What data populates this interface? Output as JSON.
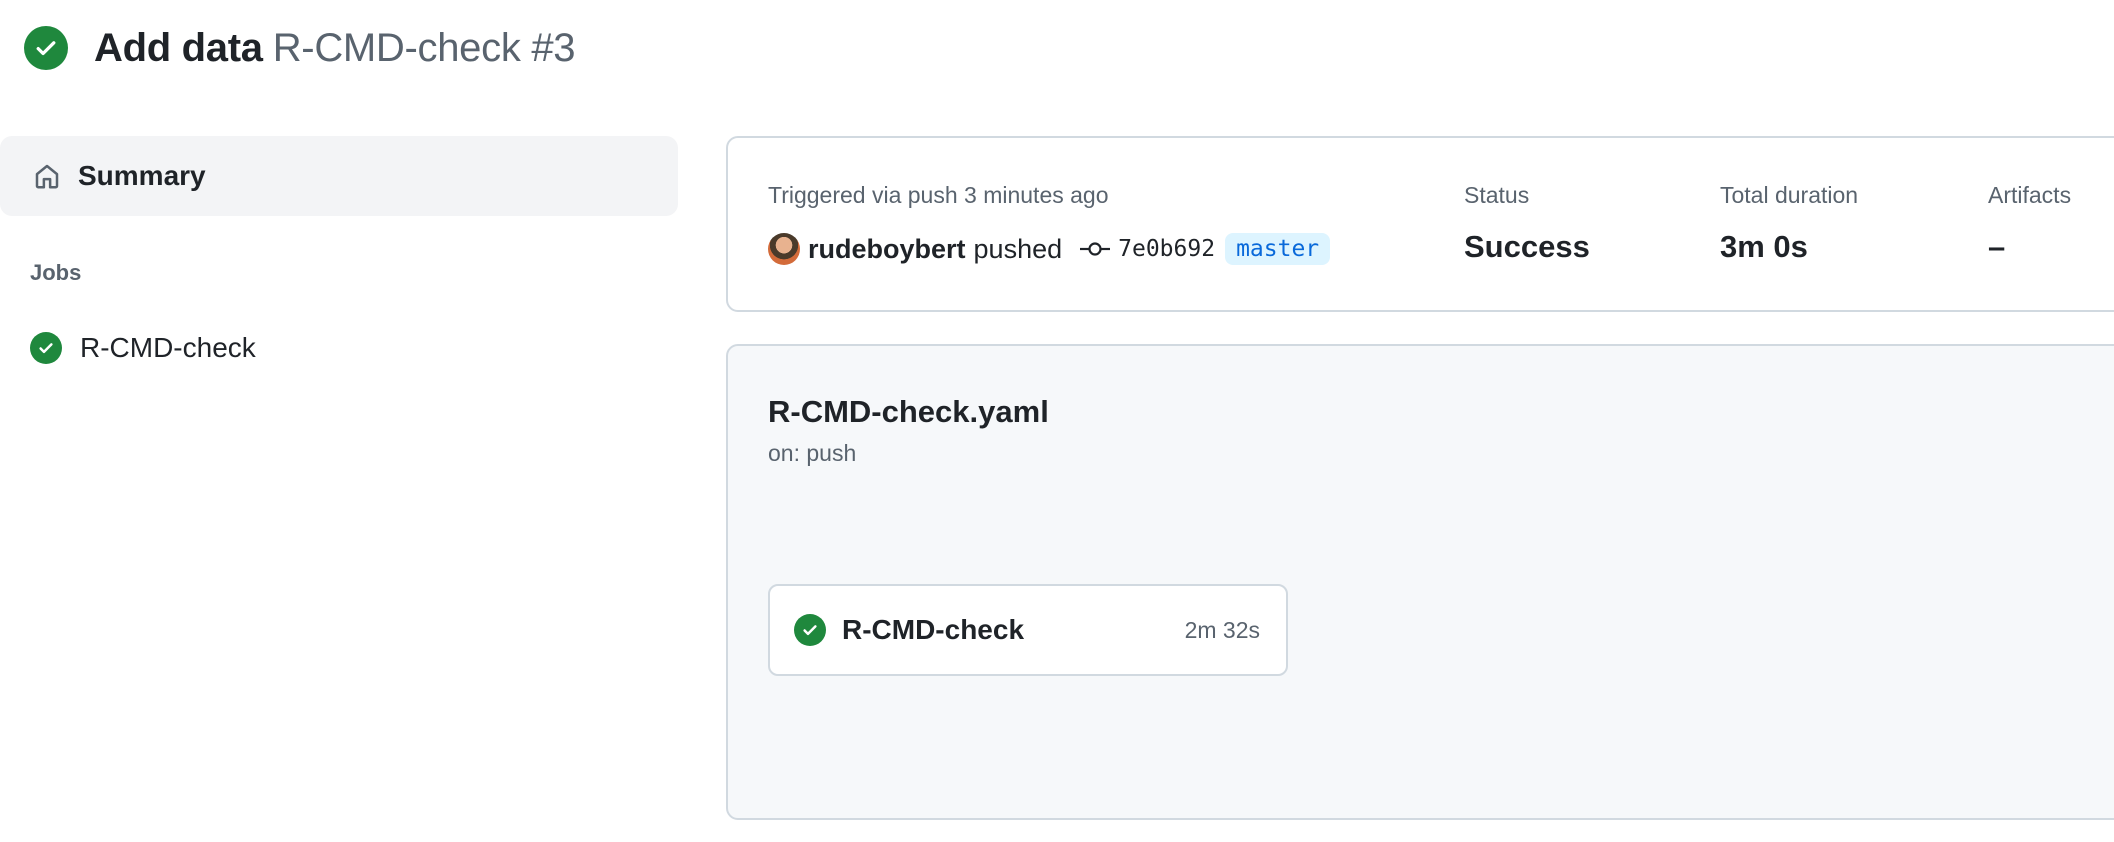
{
  "header": {
    "commit_message": "Add data",
    "workflow_run": "R-CMD-check #3",
    "status_icon": "check-circle-fill-icon"
  },
  "sidebar": {
    "summary_label": "Summary",
    "summary_icon": "home-icon",
    "jobs_heading": "Jobs",
    "jobs": [
      {
        "label": "R-CMD-check",
        "status_icon": "check-circle-fill-icon"
      }
    ]
  },
  "summary": {
    "trigger_text": "Triggered via push 3 minutes ago",
    "actor": "rudeboybert",
    "pushed_verb": "pushed",
    "commit_sha": "7e0b692",
    "branch": "master",
    "status_label": "Status",
    "status_value": "Success",
    "duration_label": "Total duration",
    "duration_value": "3m 0s",
    "artifacts_label": "Artifacts",
    "artifacts_value": "–"
  },
  "graph": {
    "workflow_file": "R-CMD-check.yaml",
    "trigger": "on: push",
    "jobs": [
      {
        "name": "R-CMD-check",
        "duration": "2m 32s"
      }
    ]
  },
  "colors": {
    "success": "#1f883d",
    "branch_bg": "#ddf4ff",
    "branch_fg": "#0969da",
    "muted_text": "#59636e",
    "border": "#d1d9e0",
    "panel_bg": "#f6f8fa"
  }
}
